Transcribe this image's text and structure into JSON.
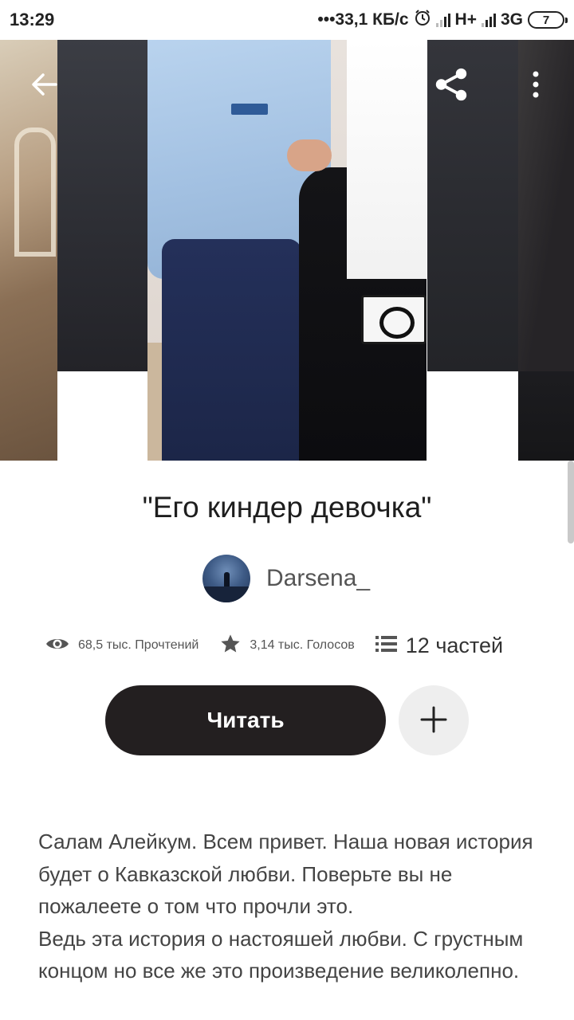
{
  "status_bar": {
    "time": "13:29",
    "net_speed": "•••33,1 КБ/с",
    "net1": "H+",
    "net2": "3G",
    "battery": "7"
  },
  "cover": {
    "icons": [
      "arrow-left-icon",
      "share-icon",
      "more-vertical-icon"
    ]
  },
  "story": {
    "title": "\"Его киндер девочка\"",
    "author": "Darsena_",
    "stats": {
      "reads": "68,5 тыс. Прочтений",
      "votes": "3,14 тыс. Голосов",
      "parts": "12 частей"
    },
    "read_label": "Читать",
    "description": "Салам Алейкум. Всем привет. Наша новая история будет о Кавказской любви. Поверьте вы не пожалеете о том что прочли это.\nВедь эта история о настояшей любви. С грустным концом но все же это произведение великолепно."
  },
  "colors": {
    "button_dark": "#231f20",
    "add_button_bg": "#eeeeee",
    "text": "#444444"
  }
}
